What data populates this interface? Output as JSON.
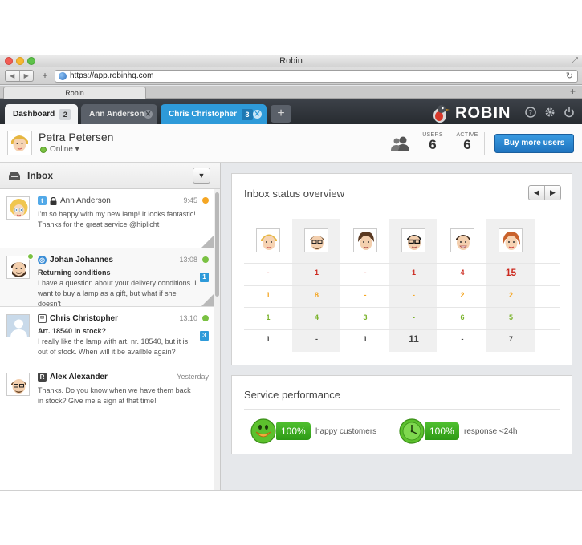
{
  "browser": {
    "window_title": "Robin",
    "url": "https://app.robinhq.com",
    "tab_title": "Robin",
    "colors": {
      "close": "#f25c54",
      "minimize": "#f7b731",
      "maximize": "#5ec24a"
    }
  },
  "app": {
    "brand": "ROBIN",
    "tabs": [
      {
        "label": "Dashboard",
        "count": "2"
      },
      {
        "label": "Ann Anderson"
      },
      {
        "label": "Chris Christopher",
        "count": "3"
      }
    ],
    "accent_color": "#2e9ad9"
  },
  "user": {
    "name": "Petra Petersen",
    "status": "Online ▾"
  },
  "stats": {
    "users_label": "USERS",
    "users_value": "6",
    "active_label": "ACTIVE",
    "active_value": "6",
    "buy_label": "Buy more users"
  },
  "inbox": {
    "title": "Inbox",
    "messages": [
      {
        "source_icon": "twitter-icon",
        "from": "Ann Anderson",
        "time": "9:45",
        "status_color": "#f5a623",
        "subject": "",
        "body": "I'm so happy with my new lamp! It looks fantastic! Thanks for the great service @hiplicht"
      },
      {
        "source_icon": "web-icon",
        "from": "Johan Johannes",
        "time": "13:08",
        "status_color": "#7ac142",
        "subject": "Returning conditions",
        "body": "I have a question about your delivery conditions. I want to buy a lamp as a gift, but what if she doesn't",
        "badge": "1"
      },
      {
        "source_icon": "mail-icon",
        "from": "Chris Christopher",
        "time": "13:10",
        "status_color": "#7ac142",
        "subject": "Art. 18540 in stock?",
        "body": "I really like the lamp with art. nr. 18540, but it is out of stock. When will it be availble again?",
        "badge": "3"
      },
      {
        "source_icon": "r-icon",
        "from": "Alex Alexander",
        "time": "Yesterday",
        "subject": "",
        "body": "Thanks. Do you know when we have them back in stock? Give me a sign at that time!"
      }
    ]
  },
  "overview": {
    "title": "Inbox status overview",
    "prev": "◀",
    "next": "▶",
    "rows": [
      [
        {
          "v": "-",
          "c": "#cc2a1f"
        },
        {
          "v": "1",
          "c": "#cc2a1f"
        },
        {
          "v": "-",
          "c": "#cc2a1f"
        },
        {
          "v": "1",
          "c": "#cc2a1f"
        },
        {
          "v": "4",
          "c": "#cc2a1f"
        },
        {
          "v": "15",
          "c": "#cc2a1f",
          "big": true
        }
      ],
      [
        {
          "v": "1",
          "c": "#f5a623"
        },
        {
          "v": "8",
          "c": "#f5a623"
        },
        {
          "v": "-",
          "c": "#f5a623"
        },
        {
          "v": "-",
          "c": "#f5a623"
        },
        {
          "v": "2",
          "c": "#f5a623"
        },
        {
          "v": "2",
          "c": "#f5a623"
        }
      ],
      [
        {
          "v": "1",
          "c": "#7ab32b"
        },
        {
          "v": "4",
          "c": "#7ab32b"
        },
        {
          "v": "3",
          "c": "#7ab32b"
        },
        {
          "v": "-",
          "c": "#7ab32b"
        },
        {
          "v": "6",
          "c": "#7ab32b"
        },
        {
          "v": "5",
          "c": "#7ab32b"
        }
      ],
      [
        {
          "v": "1",
          "c": "#444444"
        },
        {
          "v": "-",
          "c": "#444444"
        },
        {
          "v": "1",
          "c": "#444444"
        },
        {
          "v": "11",
          "c": "#444444",
          "big": true
        },
        {
          "v": "-",
          "c": "#444444"
        },
        {
          "v": "7",
          "c": "#444444"
        }
      ]
    ]
  },
  "performance": {
    "title": "Service performance",
    "items": [
      {
        "icon": "smiley-icon",
        "value": "100%",
        "label": "happy customers"
      },
      {
        "icon": "clock-icon",
        "value": "100%",
        "label": "response <24h"
      }
    ]
  }
}
